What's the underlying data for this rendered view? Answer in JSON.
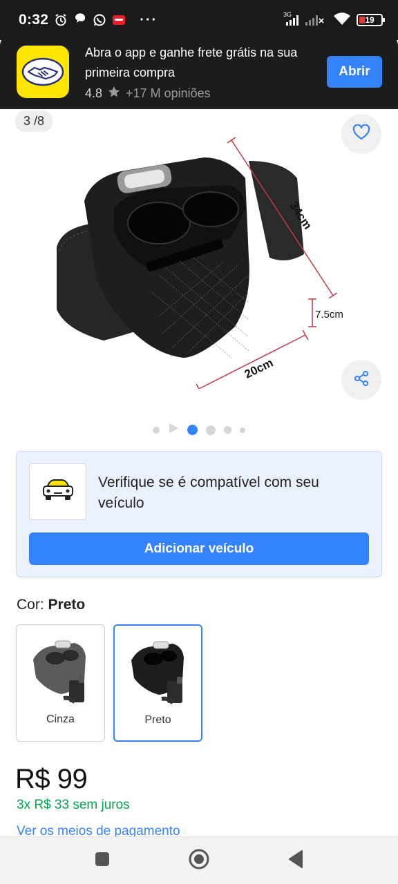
{
  "status_bar": {
    "time": "0:32",
    "network": "3G",
    "battery": "19",
    "more": "···"
  },
  "banner": {
    "title": "Abra o app e ganhe frete grátis na sua primeira compra",
    "rating": "4.8",
    "reviews": "+17 M opiniões",
    "open_label": "Abrir"
  },
  "gallery": {
    "counter": "3 /8",
    "dims": {
      "length": "34cm",
      "height": "7.5cm",
      "width": "20cm"
    },
    "current_index": 3,
    "total_dots": 5
  },
  "compat": {
    "text": "Verifique se é compatível com seu veículo",
    "button": "Adicionar veículo"
  },
  "color": {
    "label": "Cor: ",
    "selected": "Preto",
    "options": [
      {
        "name": "Cinza",
        "tone": "#5a5a5a"
      },
      {
        "name": "Preto",
        "tone": "#1e1e1e"
      }
    ]
  },
  "price": {
    "amount": "R$ 99",
    "installments": "3x R$ 33 sem juros",
    "payment_link": "Ver os meios de pagamento"
  },
  "colors": {
    "accent": "#3483fa",
    "success": "#00a650",
    "brand_yellow": "#ffe600"
  }
}
